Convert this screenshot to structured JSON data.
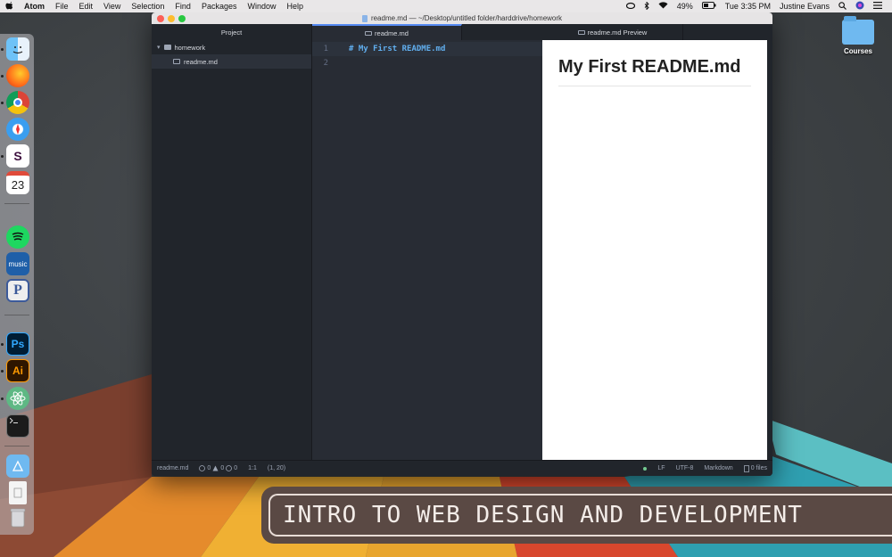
{
  "menubar": {
    "apple": "",
    "app_name": "Atom",
    "menus": [
      "File",
      "Edit",
      "View",
      "Selection",
      "Find",
      "Packages",
      "Window",
      "Help"
    ],
    "battery": "49%",
    "clock": "Tue 3:35 PM",
    "user": "Justine Evans"
  },
  "desktop": {
    "folder_label": "Courses",
    "banner_text": "INTRO TO WEB DESIGN AND DEVELOPMENT"
  },
  "dock": {
    "apps": [
      "Finder",
      "Firefox",
      "Chrome",
      "Safari",
      "Slack",
      "Calendar",
      "Spotify",
      "Amazon Music",
      "Pandora",
      "Photoshop",
      "Illustrator",
      "Atom",
      "Terminal",
      "Applications",
      "Document",
      "Trash"
    ],
    "calendar_day": "23",
    "music_label": "music",
    "pandora_label": "P",
    "ps_label": "Ps",
    "ai_label": "Ai",
    "slack_label": "S"
  },
  "window": {
    "title": "readme.md — ~/Desktop/untitled folder/harddrive/homework",
    "tabs": {
      "project": "Project",
      "readme": "readme.md",
      "preview": "readme.md Preview"
    },
    "tree": {
      "folder": "homework",
      "file": "readme.md"
    },
    "editor": {
      "line_numbers": [
        "1",
        "2"
      ],
      "lines": [
        "# My First README.md",
        ""
      ]
    },
    "preview": {
      "heading": "My First README.md"
    },
    "status": {
      "file": "readme.md",
      "errors": "0",
      "warnings": "0",
      "info": "0",
      "position": "1:1",
      "selection": "(1, 20)",
      "line_ending": "LF",
      "encoding": "UTF-8",
      "grammar": "Markdown",
      "files": "0 files"
    }
  },
  "colors": {
    "accent": "#568af2",
    "heading_code": "#61afef",
    "editor_bg": "#282c34",
    "banner_bg": "#5a4944"
  }
}
